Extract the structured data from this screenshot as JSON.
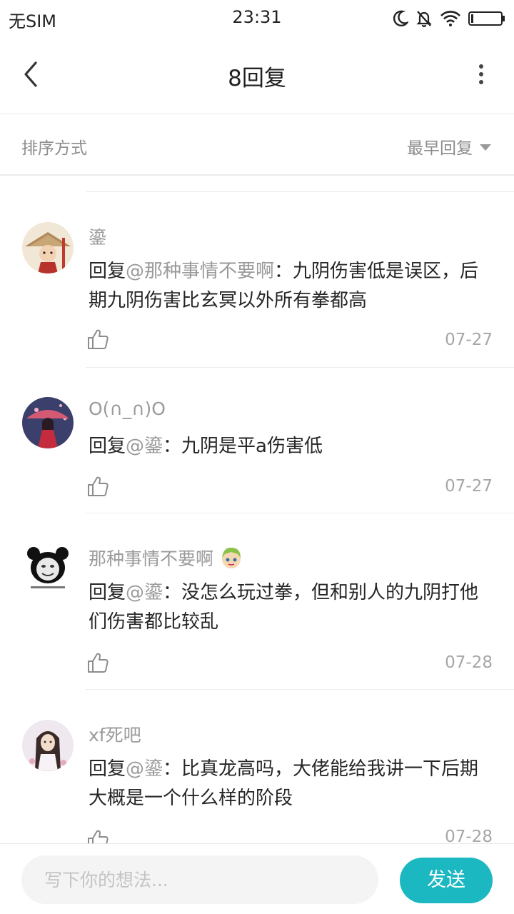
{
  "status_bar": {
    "carrier": "无SIM",
    "time": "23:31",
    "icons": [
      "moon-icon",
      "bell-off-icon",
      "wifi-icon",
      "battery-icon"
    ]
  },
  "nav": {
    "title": "8回复",
    "back_icon": "chevron-left-icon",
    "more_icon": "more-vertical-icon"
  },
  "sort": {
    "label": "排序方式",
    "value": "最早回复"
  },
  "comments": [
    {
      "user": "鎏",
      "reply_prefix": "回复",
      "mention": "@那种事情不要啊",
      "text": "：九阴伤害低是误区，后期九阴伤害比玄冥以外所有拳都高",
      "date": "07-27"
    },
    {
      "user": "O(∩_∩)O",
      "reply_prefix": "回复",
      "mention": "@鎏",
      "text": "：九阴是平a伤害低",
      "date": "07-27"
    },
    {
      "user": "那种事情不要啊",
      "reply_prefix": "回复",
      "mention": "@鎏",
      "text": "：没怎么玩过拳，但和别人的九阴打他们伤害都比较乱",
      "date": "07-28"
    },
    {
      "user": "xf死吧",
      "reply_prefix": "回复",
      "mention": "@鎏",
      "text": "：比真龙高吗，大佬能给我讲一下后期大概是一个什么样的阶段",
      "date": "07-28"
    }
  ],
  "bottom": {
    "placeholder": "写下你的想法...",
    "send_label": "发送"
  },
  "colors": {
    "accent": "#1cb8c2",
    "muted_text": "#9a9a9a",
    "body_text": "#262626"
  }
}
